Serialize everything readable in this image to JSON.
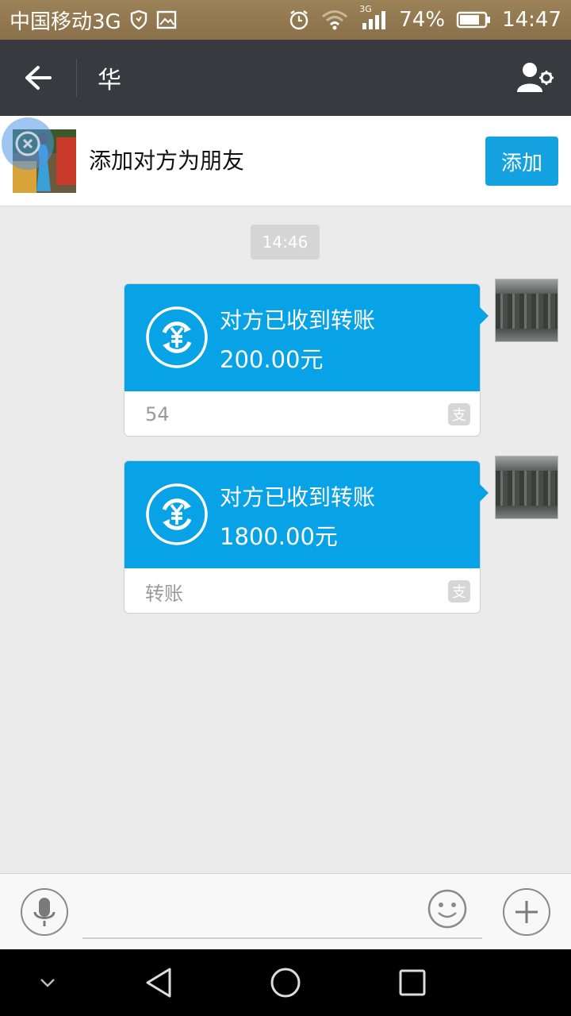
{
  "status_bar": {
    "carrier": "中国移动3G",
    "network": "3G",
    "battery": "74%",
    "time": "14:47"
  },
  "header": {
    "title": "华"
  },
  "add_banner": {
    "text": "添加对方为朋友",
    "button_label": "添加"
  },
  "chat": {
    "timestamp": "14:46",
    "messages": [
      {
        "title": "对方已收到转账",
        "amount": "200.00元",
        "note": "54",
        "badge": "支"
      },
      {
        "title": "对方已收到转账",
        "amount": "1800.00元",
        "note": "转账",
        "badge": "支"
      }
    ]
  },
  "colors": {
    "accent": "#08a2e6",
    "header_bg": "#393a3f",
    "status_bg": "#8a7049"
  },
  "icons": {
    "back": "arrow-left-icon",
    "profile": "user-settings-icon",
    "transfer": "yuan-refresh-icon",
    "voice": "microphone-icon",
    "emoji": "smiley-icon",
    "plus": "plus-icon"
  }
}
